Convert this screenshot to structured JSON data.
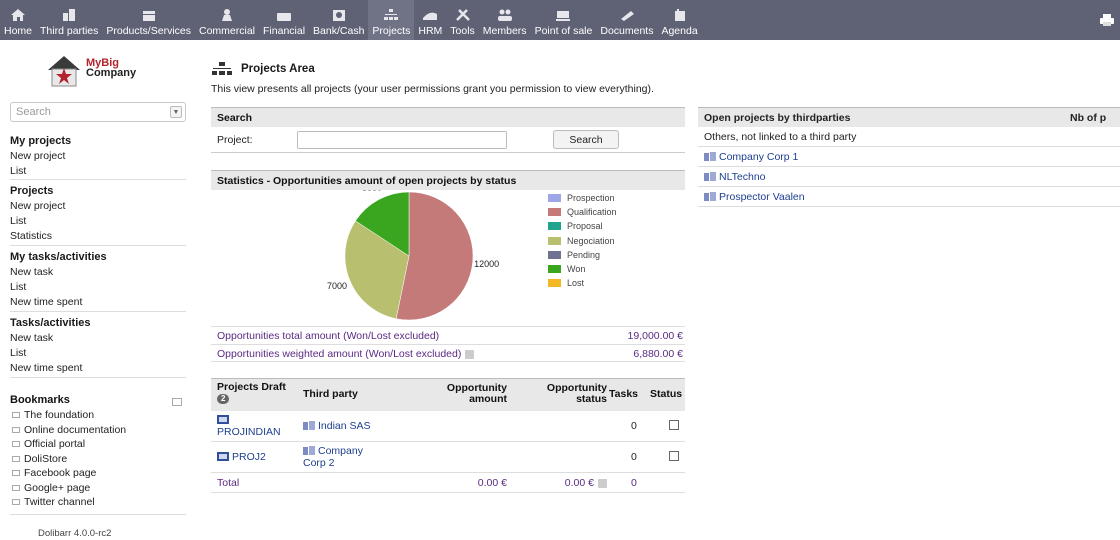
{
  "topbar": {
    "menus": [
      {
        "label": "Home",
        "icon": "home-icon"
      },
      {
        "label": "Third parties",
        "icon": "building-icon"
      },
      {
        "label": "Products/Services",
        "icon": "box-icon"
      },
      {
        "label": "Commercial",
        "icon": "person-icon"
      },
      {
        "label": "Financial",
        "icon": "money-icon"
      },
      {
        "label": "Bank/Cash",
        "icon": "bank-icon"
      },
      {
        "label": "Projects",
        "icon": "projects-icon"
      },
      {
        "label": "HRM",
        "icon": "hrm-icon"
      },
      {
        "label": "Tools",
        "icon": "tools-icon"
      },
      {
        "label": "Members",
        "icon": "members-icon"
      },
      {
        "label": "Point of sale",
        "icon": "pos-icon"
      },
      {
        "label": "Documents",
        "icon": "documents-icon"
      },
      {
        "label": "Agenda",
        "icon": "agenda-icon"
      }
    ],
    "active": "Projects"
  },
  "sidebar": {
    "logo_line1": "MyBig",
    "logo_line2": "Company",
    "search_placeholder": "Search",
    "blocks": [
      {
        "title": "My projects",
        "items": [
          "New project",
          "List"
        ]
      },
      {
        "title": "Projects",
        "items": [
          "New project",
          "List",
          "Statistics"
        ]
      },
      {
        "title": "My tasks/activities",
        "items": [
          "New task",
          "List",
          "New time spent"
        ]
      },
      {
        "title": "Tasks/activities",
        "items": [
          "New task",
          "List",
          "New time spent"
        ]
      }
    ],
    "bookmarks_title": "Bookmarks",
    "bookmarks": [
      "The foundation",
      "Online documentation",
      "Official portal",
      "DoliStore",
      "Facebook page",
      "Google+ page",
      "Twitter channel"
    ],
    "version": "Dolibarr 4.0.0-rc2"
  },
  "main": {
    "title": "Projects Area",
    "description": "This view presents all projects (your user permissions grant you permission to view everything).",
    "search": {
      "title": "Search",
      "project_label": "Project:",
      "project_value": "",
      "button": "Search"
    },
    "stats_title": "Statistics - Opportunities amount of open projects by status",
    "opp_total_label": "Opportunities total amount (Won/Lost excluded)",
    "opp_total_value": "19,000.00 €",
    "opp_weighted_label": "Opportunities weighted amount (Won/Lost excluded)",
    "opp_weighted_value": "6,880.00 €",
    "drafts": {
      "headers": {
        "project": "Projects Draft",
        "count": "2",
        "thirdparty": "Third party",
        "opp_amount_1": "Opportunity",
        "opp_amount_2": "amount",
        "opp_status_1": "Opportunity",
        "opp_status_2": "status",
        "tasks": "Tasks",
        "status": "Status"
      },
      "rows": [
        {
          "ref": "PROJINDIAN",
          "thirdparty_1": "Indian SAS",
          "thirdparty_2": "",
          "tasks": "0"
        },
        {
          "ref": "PROJ2",
          "thirdparty_1": "Company",
          "thirdparty_2": "Corp 2",
          "tasks": "0"
        }
      ],
      "total": {
        "label": "Total",
        "amount": "0.00 €",
        "status": "0.00 €",
        "tasks": "0"
      }
    },
    "open_thirdparties": {
      "title": "Open projects by thirdparties",
      "count_header": "Nb of p",
      "rows": [
        "Others, not linked to a third party",
        "Company Corp 1",
        "NLTechno",
        "Prospector Vaalen"
      ]
    }
  },
  "chart_data": {
    "type": "pie",
    "title": "",
    "categories": [
      "Prospection",
      "Qualification",
      "Proposal",
      "Negociation",
      "Pending",
      "Won",
      "Lost"
    ],
    "values": [
      0,
      12000,
      0,
      7000,
      0,
      3550,
      0
    ],
    "colors": [
      "#9ea7e6",
      "#c47a78",
      "#1fa38d",
      "#b8bf6e",
      "#6f7290",
      "#3aa620",
      "#f2b826"
    ],
    "labels_shown": [
      "12000",
      "7000",
      "3550"
    ],
    "legend": "right"
  }
}
